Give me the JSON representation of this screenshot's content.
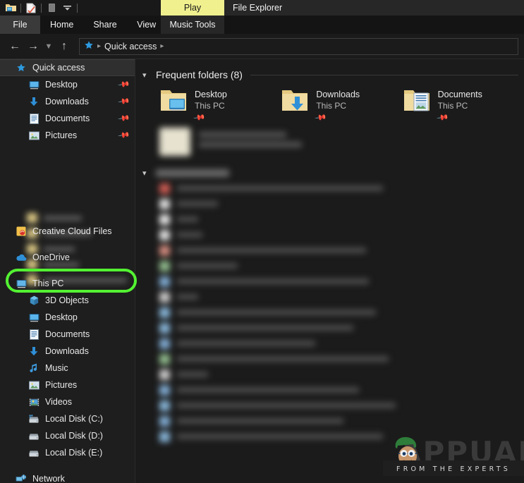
{
  "window": {
    "titlebar": {
      "quick_access_icons": [
        "folder-icon",
        "properties-icon",
        "undo-icon",
        "customize-dropdown-icon"
      ],
      "contextual_tab_group": "Play",
      "app_title": "File Explorer"
    },
    "ribbon": {
      "tabs": [
        {
          "label": "File",
          "active": true
        },
        {
          "label": "Home",
          "active": false
        },
        {
          "label": "Share",
          "active": false
        },
        {
          "label": "View",
          "active": false
        }
      ],
      "contextual_tab": "Music Tools"
    },
    "navbar": {
      "back_icon": "back-arrow-icon",
      "forward_icon": "forward-arrow-icon",
      "recent_icon": "chevron-down-icon",
      "up_icon": "up-arrow-icon",
      "breadcrumb": {
        "root_icon": "quick-access-star-icon",
        "items": [
          "Quick access"
        ]
      }
    }
  },
  "sidebar": {
    "items": [
      {
        "label": "Quick access",
        "icon": "quick-access-star-icon",
        "level": 0,
        "selected": true,
        "pinned": false
      },
      {
        "label": "Desktop",
        "icon": "desktop-monitor-icon",
        "level": 1,
        "selected": false,
        "pinned": true
      },
      {
        "label": "Downloads",
        "icon": "downloads-arrow-icon",
        "level": 1,
        "selected": false,
        "pinned": true
      },
      {
        "label": "Documents",
        "icon": "documents-icon",
        "level": 1,
        "selected": false,
        "pinned": true
      },
      {
        "label": "Pictures",
        "icon": "pictures-icon",
        "level": 1,
        "selected": false,
        "pinned": true
      },
      {
        "label": "Creative Cloud Files",
        "icon": "creative-cloud-icon",
        "level": 0,
        "selected": false,
        "pinned": false
      },
      {
        "label": "OneDrive",
        "icon": "onedrive-cloud-icon",
        "level": 0,
        "selected": false,
        "pinned": false
      },
      {
        "label": "This PC",
        "icon": "this-pc-monitor-icon",
        "level": 0,
        "selected": false,
        "pinned": false
      },
      {
        "label": "3D Objects",
        "icon": "3d-objects-icon",
        "level": 1,
        "selected": false,
        "pinned": false
      },
      {
        "label": "Desktop",
        "icon": "desktop-monitor-icon",
        "level": 1,
        "selected": false,
        "pinned": false
      },
      {
        "label": "Documents",
        "icon": "documents-icon",
        "level": 1,
        "selected": false,
        "pinned": false
      },
      {
        "label": "Downloads",
        "icon": "downloads-arrow-icon",
        "level": 1,
        "selected": false,
        "pinned": false
      },
      {
        "label": "Music",
        "icon": "music-note-icon",
        "level": 1,
        "selected": false,
        "pinned": false
      },
      {
        "label": "Pictures",
        "icon": "pictures-icon",
        "level": 1,
        "selected": false,
        "pinned": false
      },
      {
        "label": "Videos",
        "icon": "videos-icon",
        "level": 1,
        "selected": false,
        "pinned": false
      },
      {
        "label": "Local Disk (C:)",
        "icon": "system-drive-icon",
        "level": 1,
        "selected": false,
        "pinned": false
      },
      {
        "label": "Local Disk (D:)",
        "icon": "drive-icon",
        "level": 1,
        "selected": false,
        "pinned": false
      },
      {
        "label": "Local Disk (E:)",
        "icon": "drive-icon",
        "level": 1,
        "selected": false,
        "pinned": false
      },
      {
        "label": "Network",
        "icon": "network-icon",
        "level": 0,
        "selected": false,
        "pinned": false
      }
    ]
  },
  "content": {
    "frequent_folders": {
      "header": "Frequent folders (8)",
      "collapse_icon": "chevron-down-icon",
      "tiles": [
        {
          "name": "Desktop",
          "location": "This PC",
          "icon": "folder-desktop-icon",
          "pinned": true
        },
        {
          "name": "Downloads",
          "location": "This PC",
          "icon": "folder-downloads-icon",
          "pinned": true
        },
        {
          "name": "Documents",
          "location": "This PC",
          "icon": "folder-documents-icon",
          "pinned": true
        }
      ]
    },
    "recent_files": {
      "collapse_icon": "chevron-down-icon",
      "blurred": true,
      "row_count": 17
    }
  },
  "annotation": {
    "target": "This PC",
    "color": "#53f132",
    "shape": "rounded-rectangle-highlight"
  },
  "watermark": {
    "brand": "APPUALS",
    "tagline": "FROM THE EXPERTS"
  }
}
